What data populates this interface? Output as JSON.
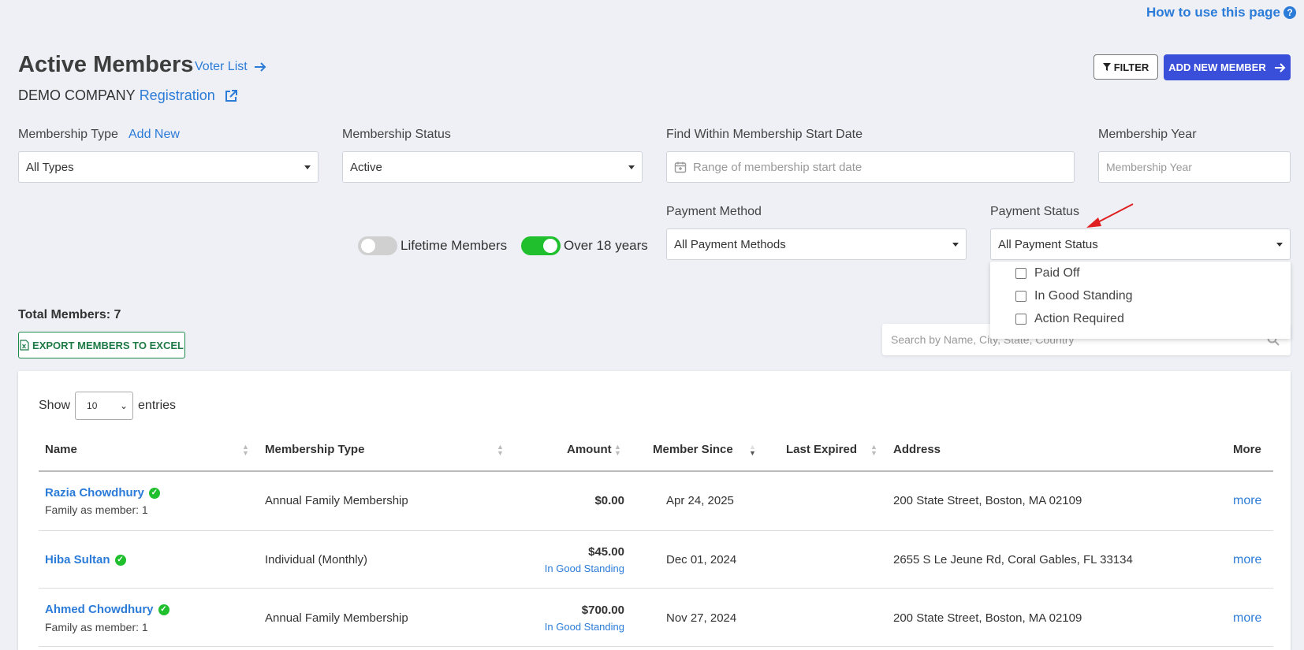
{
  "help_link": "How to use this page",
  "page_title": "Active Members",
  "voter_list": "Voter List",
  "company_name": "DEMO COMPANY",
  "registration_link": "Registration",
  "filter_button": "FILTER",
  "add_member_button": "ADD NEW MEMBER",
  "filters": {
    "membership_type_label": "Membership Type",
    "add_new_link": "Add New",
    "membership_type_value": "All Types",
    "membership_status_label": "Membership Status",
    "membership_status_value": "Active",
    "start_date_label": "Find Within Membership Start Date",
    "start_date_placeholder": "Range of membership start date",
    "membership_year_label": "Membership Year",
    "membership_year_placeholder": "Membership Year",
    "lifetime_label": "Lifetime Members",
    "lifetime_on": false,
    "over18_label": "Over 18 years",
    "over18_on": true,
    "payment_method_label": "Payment Method",
    "payment_method_value": "All Payment Methods",
    "payment_status_label": "Payment Status",
    "payment_status_value": "All Payment Status",
    "payment_status_options": [
      "Paid Off",
      "In Good Standing",
      "Action Required"
    ]
  },
  "total_members": "Total Members: 7",
  "export_button": "EXPORT MEMBERS TO EXCEL",
  "search_placeholder": "Search by Name, City, State, Country",
  "table": {
    "show_label": "Show",
    "entries_value": "10",
    "entries_label": "entries",
    "headers": [
      "Name",
      "Membership Type",
      "Amount",
      "Member Since",
      "Last Expired",
      "Address",
      "More"
    ],
    "rows": [
      {
        "name": "Razia Chowdhury",
        "sub": "Family as member: 1",
        "type": "Annual Family Membership",
        "amount": "$0.00",
        "standing": "",
        "since": "Apr 24, 2025",
        "expired": "",
        "address": "200 State Street, Boston, MA 02109",
        "more": "more"
      },
      {
        "name": "Hiba Sultan",
        "sub": "",
        "type": "Individual (Monthly)",
        "amount": "$45.00",
        "standing": "In Good Standing",
        "since": "Dec 01, 2024",
        "expired": "",
        "address": "2655 S Le Jeune Rd, Coral Gables, FL 33134",
        "more": "more"
      },
      {
        "name": "Ahmed Chowdhury",
        "sub": "Family as member: 1",
        "type": "Annual Family Membership",
        "amount": "$700.00",
        "standing": "In Good Standing",
        "since": "Nov 27, 2024",
        "expired": "",
        "address": "200 State Street, Boston, MA 02109",
        "more": "more"
      }
    ]
  },
  "colors": {
    "primary": "#3a4fd9",
    "link": "#2b7bd8",
    "success": "#1fbf2e",
    "export": "#1e7a45",
    "arrow": "#e02020"
  }
}
